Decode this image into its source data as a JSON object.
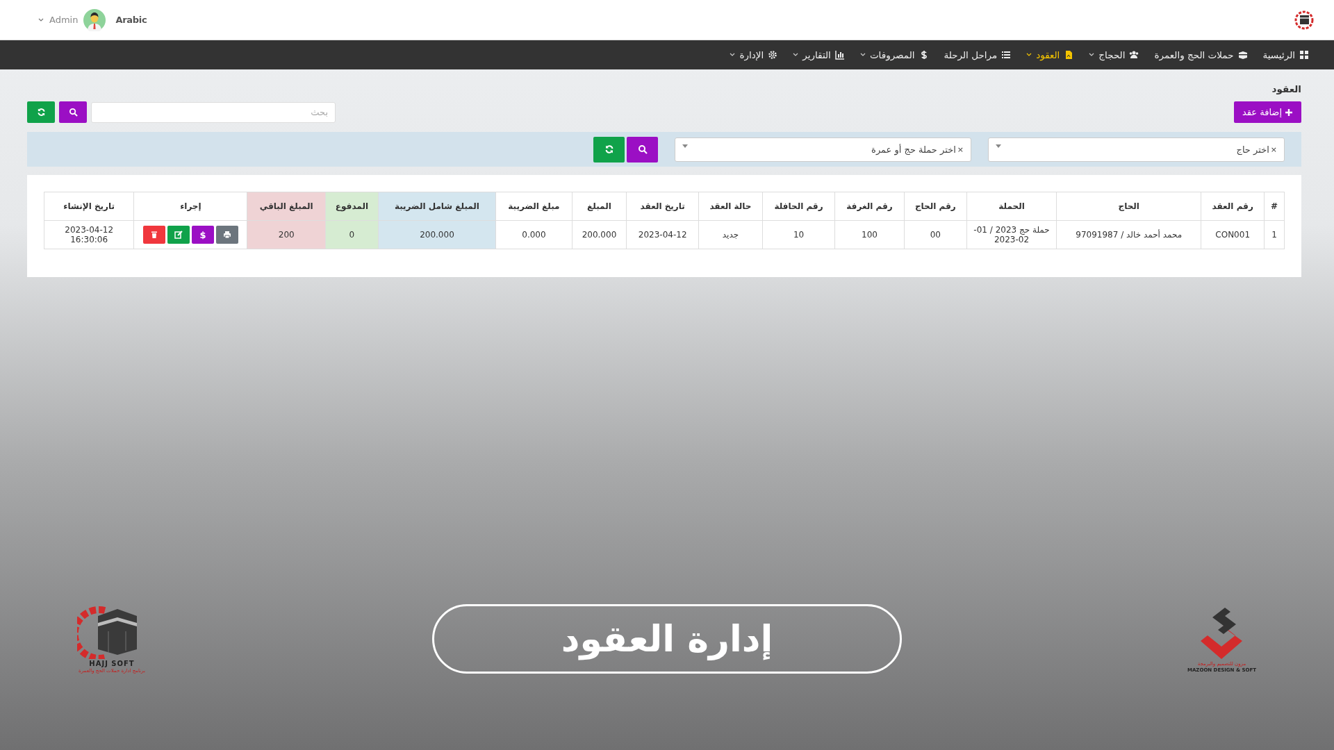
{
  "header": {
    "language": "Arabic",
    "user": "Admin"
  },
  "nav": [
    {
      "label": "الرئيسية",
      "dropdown": false,
      "selected": false
    },
    {
      "label": "حملات الحج والعمرة",
      "dropdown": false,
      "selected": false
    },
    {
      "label": "الحجاج",
      "dropdown": true,
      "selected": false
    },
    {
      "label": "العقود",
      "dropdown": true,
      "selected": true
    },
    {
      "label": "مراحل الرحلة",
      "dropdown": false,
      "selected": false
    },
    {
      "label": "المصروفات",
      "dropdown": true,
      "selected": false
    },
    {
      "label": "التقارير",
      "dropdown": true,
      "selected": false
    },
    {
      "label": "الإدارة",
      "dropdown": true,
      "selected": false
    }
  ],
  "page_title": "العقود",
  "add_button": "إضافة عقد",
  "search": {
    "placeholder": "بحث"
  },
  "filters": [
    {
      "placeholder": "اختر حاج",
      "clear": "×"
    },
    {
      "placeholder": "اختر حملة حج أو عمرة",
      "clear": "×"
    }
  ],
  "table": {
    "columns": [
      {
        "label": "#"
      },
      {
        "label": "رقم العقد"
      },
      {
        "label": "الحاج"
      },
      {
        "label": "الحملة"
      },
      {
        "label": "رقم الحاج"
      },
      {
        "label": "رقم الغرفة"
      },
      {
        "label": "رقم الحافلة"
      },
      {
        "label": "حالة العقد"
      },
      {
        "label": "تاريخ العقد"
      },
      {
        "label": "المبلغ"
      },
      {
        "label": "مبلغ الضريبة"
      },
      {
        "label": "المبلغ شامل الضريبة",
        "color": "#d4e6ef"
      },
      {
        "label": "المدفوع",
        "color": "#d6ecd2"
      },
      {
        "label": "المبلغ الباقي",
        "color": "#efd3d5"
      },
      {
        "label": "إجراء"
      },
      {
        "label": "تاريخ الإنشاء"
      }
    ],
    "rows": [
      {
        "cells": [
          "1",
          "CON001",
          "محمد أحمد خالد / 97091987",
          "حملة حج 2023 / 01-02-2023",
          "00",
          "100",
          "10",
          "جديد",
          "2023-04-12",
          "200.000",
          "0.000",
          "200.000",
          "0",
          "200",
          null,
          "2023-04-12 16:30:06"
        ],
        "actions": [
          {
            "kind": "print"
          },
          {
            "kind": "pay",
            "label": "$"
          },
          {
            "kind": "edit"
          },
          {
            "kind": "delete"
          }
        ]
      }
    ]
  },
  "caption": "إدارة العقود",
  "logos": [
    {
      "name": "MAZOON DESIGN & SOFT",
      "tagline": "مزون للتصميم والبرمجة"
    },
    {
      "name": "HAJJ SOFT",
      "tagline": "برنامج ادارة حملات الحج والعمرة"
    }
  ]
}
